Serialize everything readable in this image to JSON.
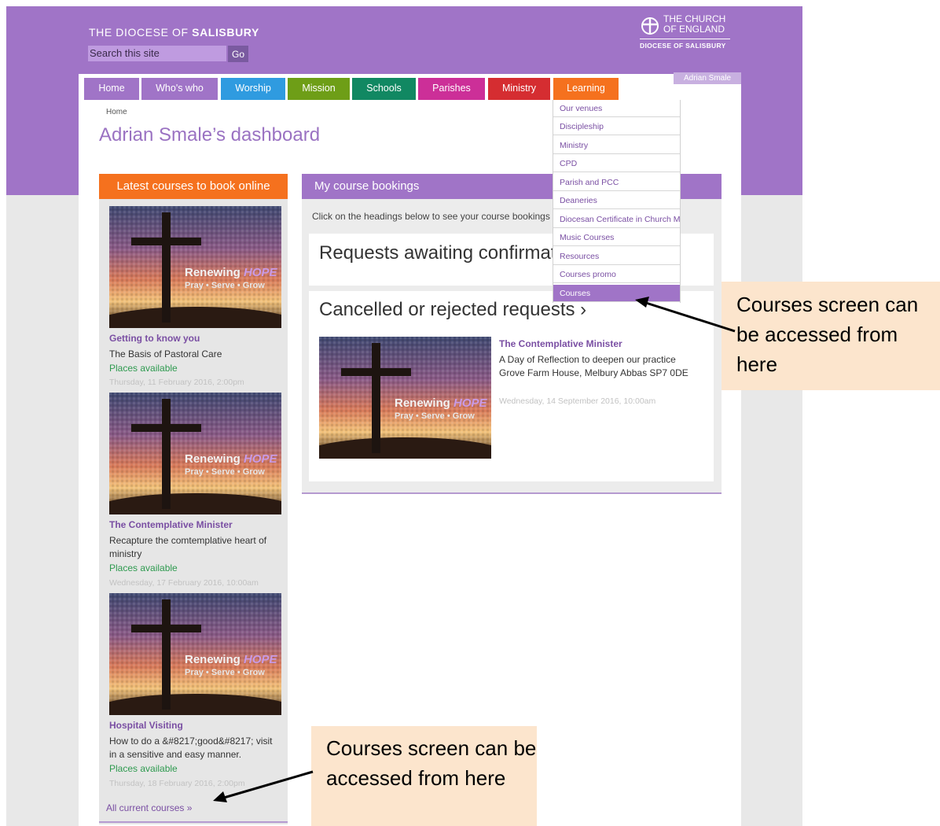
{
  "site": {
    "title_light": "THE DIOCESE OF",
    "title_bold": "SALISBURY",
    "search_placeholder": "Search this site",
    "go_label": "Go",
    "logo_line1": "THE CHURCH",
    "logo_line2": "OF ENGLAND",
    "logo_line3": "DIOCESE OF SALISBURY",
    "user_name": "Adrian Smale"
  },
  "nav": {
    "tabs": [
      {
        "label": "Home",
        "color": "#a074c7"
      },
      {
        "label": "Who's who",
        "color": "#a074c7"
      },
      {
        "label": "Worship",
        "color": "#2f9be0"
      },
      {
        "label": "Mission",
        "color": "#6e9e17"
      },
      {
        "label": "Schools",
        "color": "#118862"
      },
      {
        "label": "Parishes",
        "color": "#cc2f98"
      },
      {
        "label": "Ministry",
        "color": "#d52d31"
      },
      {
        "label": "Learning",
        "color": "#f5711e"
      }
    ],
    "learning_menu": [
      "Our venues",
      "Discipleship",
      "Ministry",
      "CPD",
      "Parish and PCC",
      "Deaneries",
      "Diocesan Certificate in Church Music",
      "Music Courses",
      "Resources",
      "Courses promo",
      "Courses"
    ]
  },
  "page": {
    "breadcrumb": "Home",
    "title": "Adrian Smale’s dashboard"
  },
  "latest": {
    "heading": "Latest courses to book online",
    "image_title": "Renewing",
    "image_title_accent": "HOPE",
    "image_subtitle": "Pray • Serve • Grow",
    "courses": [
      {
        "title": "Getting to know you",
        "desc": "The Basis of Pastoral Care",
        "status": "Places available",
        "date": "Thursday, 11 February 2016, 2:00pm"
      },
      {
        "title": "The Contemplative Minister",
        "desc": "Recapture the comtemplative heart of ministry",
        "status": "Places available",
        "date": "Wednesday, 17 February 2016, 10:00am"
      },
      {
        "title": "Hospital Visiting",
        "desc": "How to do a &#8217;good&#8217; visit in a sensitive and easy manner.",
        "status": "Places available",
        "date": "Thursday, 18 February 2016, 2:00pm"
      }
    ],
    "all_link": "All current courses »"
  },
  "bookings": {
    "heading": "My course bookings",
    "intro": "Click on the headings below to see your course bookings",
    "requests_heading": "Requests awaiting confirmation",
    "cancelled_heading": "Cancelled or rejected requests ›",
    "item": {
      "title": "The Contemplative Minister",
      "desc": "A Day of Reflection to deepen our practice Grove Farm House, Melbury Abbas SP7 0DE",
      "date": "Wednesday, 14 September 2016, 10:00am"
    }
  },
  "callouts": {
    "top": "Courses screen can be accessed from here",
    "bottom": "Courses screen can be accessed from here"
  }
}
